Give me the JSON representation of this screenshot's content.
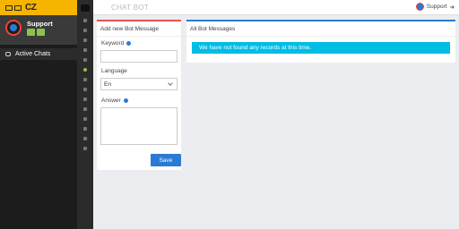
{
  "sidebar": {
    "logo_text": "CZ",
    "profile_name": "Support",
    "nav": [
      {
        "label": "Active Chats",
        "icon": "chat-icon"
      }
    ]
  },
  "header": {
    "title": "CHAT BOT",
    "user": "Support"
  },
  "add_panel": {
    "title": "Add new Bot Message",
    "keyword_label": "Keyword",
    "keyword_value": "",
    "language_label": "Language",
    "language_value": "En",
    "answer_label": "Answer",
    "answer_value": "",
    "save_label": "Save"
  },
  "all_panel": {
    "title": "All Bot Messages",
    "empty_message": "We have not found any records at this time."
  },
  "colors": {
    "logo_bg": "#f4b400",
    "accent_red": "#e4544c",
    "accent_blue": "#2a7bd4",
    "alert_bg": "#00bde6",
    "sidebar_bg": "#1c1c1c"
  }
}
